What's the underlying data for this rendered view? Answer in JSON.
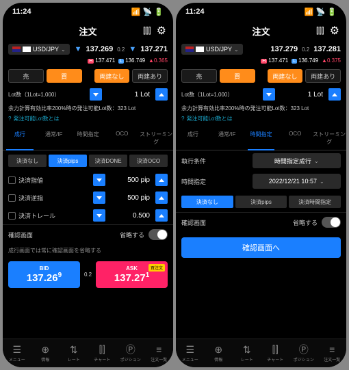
{
  "time": "11:24",
  "header": {
    "title": "注文"
  },
  "left": {
    "pair": "USD/JPY",
    "bid": "137.269",
    "ask": "137.271",
    "spread": "0.2",
    "high": "137.471",
    "low": "136.749",
    "delta": "0.365",
    "sellLabel": "売",
    "buyLabel": "買",
    "crossNone": "両建なし",
    "crossYes": "両建あり",
    "lotLabel": "Lot数（1Lot=1,000）",
    "lotValue": "1 Lot",
    "marginInfo": "余力計算有効比率200%時の発注可能Lot数：323 Lot",
    "lotLink": "発注可能Lot数とは",
    "tabs": [
      "成行",
      "通常/IF",
      "時間指定",
      "OCO",
      "ストリーミング"
    ],
    "settleTabs": [
      "決済なし",
      "決済pips",
      "決済DONE",
      "決済OCO"
    ],
    "fields": [
      {
        "label": "決済指値",
        "value": "500 pip"
      },
      {
        "label": "決済逆指",
        "value": "500 pip"
      },
      {
        "label": "決済トレール",
        "value": "0.500"
      }
    ],
    "confirmLabel": "確認画面",
    "omitLabel": "省略する",
    "note": "成行画面では常に確認画面を省略する",
    "bidBox": {
      "label": "BID",
      "big": "137.26",
      "sup": "9"
    },
    "askBox": {
      "label": "ASK",
      "badge": "買注文",
      "big": "137.27",
      "sup": "1"
    }
  },
  "right": {
    "pair": "USD/JPY",
    "bid": "137.279",
    "ask": "137.281",
    "spread": "0.2",
    "high": "137.471",
    "low": "136.749",
    "delta": "0.375",
    "sellLabel": "売",
    "buyLabel": "買",
    "crossNone": "両建なし",
    "crossYes": "両建あり",
    "lotLabel": "Lot数（1Lot=1,000）",
    "lotValue": "1 Lot",
    "marginInfo": "余力計算有効比率200%時の発注可能Lot数：323 Lot",
    "lotLink": "発注可能Lot数とは",
    "tabs": [
      "成行",
      "通常/IF",
      "時間指定",
      "OCO",
      "ストリーミング"
    ],
    "execLabel": "執行条件",
    "execValue": "時間指定成行",
    "timeLabel": "時間指定",
    "timeValue": "2022/12/21 10:57",
    "segTabs": [
      "決済なし",
      "決済pips",
      "決済時間指定"
    ],
    "confirmLabel": "確認画面",
    "omitLabel": "省略する",
    "confirmBtn": "確認画面へ"
  },
  "nav": [
    "メニュー",
    "情報",
    "レート",
    "チャート",
    "ポジション",
    "注文一覧"
  ]
}
